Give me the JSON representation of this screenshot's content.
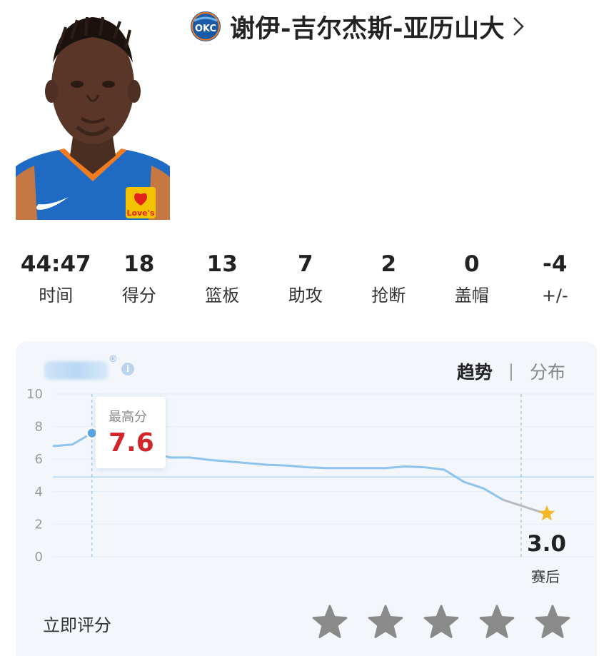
{
  "player": {
    "name": "谢伊-吉尔杰斯-亚历山大",
    "team_logo_text": "OKC",
    "jersey_sponsor": "Love's"
  },
  "stats": [
    {
      "value": "44:47",
      "label": "时间"
    },
    {
      "value": "18",
      "label": "得分"
    },
    {
      "value": "13",
      "label": "篮板"
    },
    {
      "value": "7",
      "label": "助攻"
    },
    {
      "value": "2",
      "label": "抢断"
    },
    {
      "value": "0",
      "label": "盖帽"
    },
    {
      "value": "-4",
      "label": "+/-"
    }
  ],
  "rating_panel": {
    "tabs": {
      "trend": "趋势",
      "separator": "|",
      "distribution": "分布"
    },
    "info_icon": "i",
    "registered_mark": "®",
    "tooltip": {
      "label": "最高分",
      "value": "7.6"
    },
    "final": {
      "score": "3.0",
      "label": "赛后"
    },
    "rate_now_label": "立即评分",
    "star_count": 5
  },
  "chart_data": {
    "type": "line",
    "ylim": [
      0,
      10
    ],
    "y_ticks": [
      "10",
      "8",
      "6",
      "4",
      "2",
      "0"
    ],
    "reference_line": 4.9,
    "x": [
      0,
      2,
      4,
      6,
      8,
      10,
      12,
      14,
      16,
      18,
      20,
      22,
      24,
      26,
      28,
      30,
      32,
      34,
      36,
      38,
      40,
      42,
      44,
      46,
      48
    ],
    "values": [
      6.8,
      6.9,
      7.6,
      7.4,
      7.0,
      6.4,
      6.1,
      6.1,
      5.95,
      5.85,
      5.75,
      5.65,
      5.6,
      5.5,
      5.45,
      5.45,
      5.45,
      5.45,
      5.55,
      5.5,
      5.35,
      4.6,
      4.2,
      3.5,
      3.0
    ],
    "peak": {
      "x": 4,
      "value": 7.6
    },
    "final_point": {
      "value": 3.0
    },
    "colors": {
      "line": "#8fc4ec",
      "peak_dot": "#5ba3e0",
      "final_star": "#f5b82a",
      "grid": "#dde6f0",
      "reference": "#bfe0f3"
    }
  },
  "colors": {
    "card_bg": "#f3f7fc",
    "tooltip_value": "#d3252c",
    "star_inactive": "#8a8a8a"
  },
  "icons": {
    "team_logo": "okc-logo-icon",
    "name_chevron": "chevron-right-icon",
    "star": "star-icon"
  }
}
